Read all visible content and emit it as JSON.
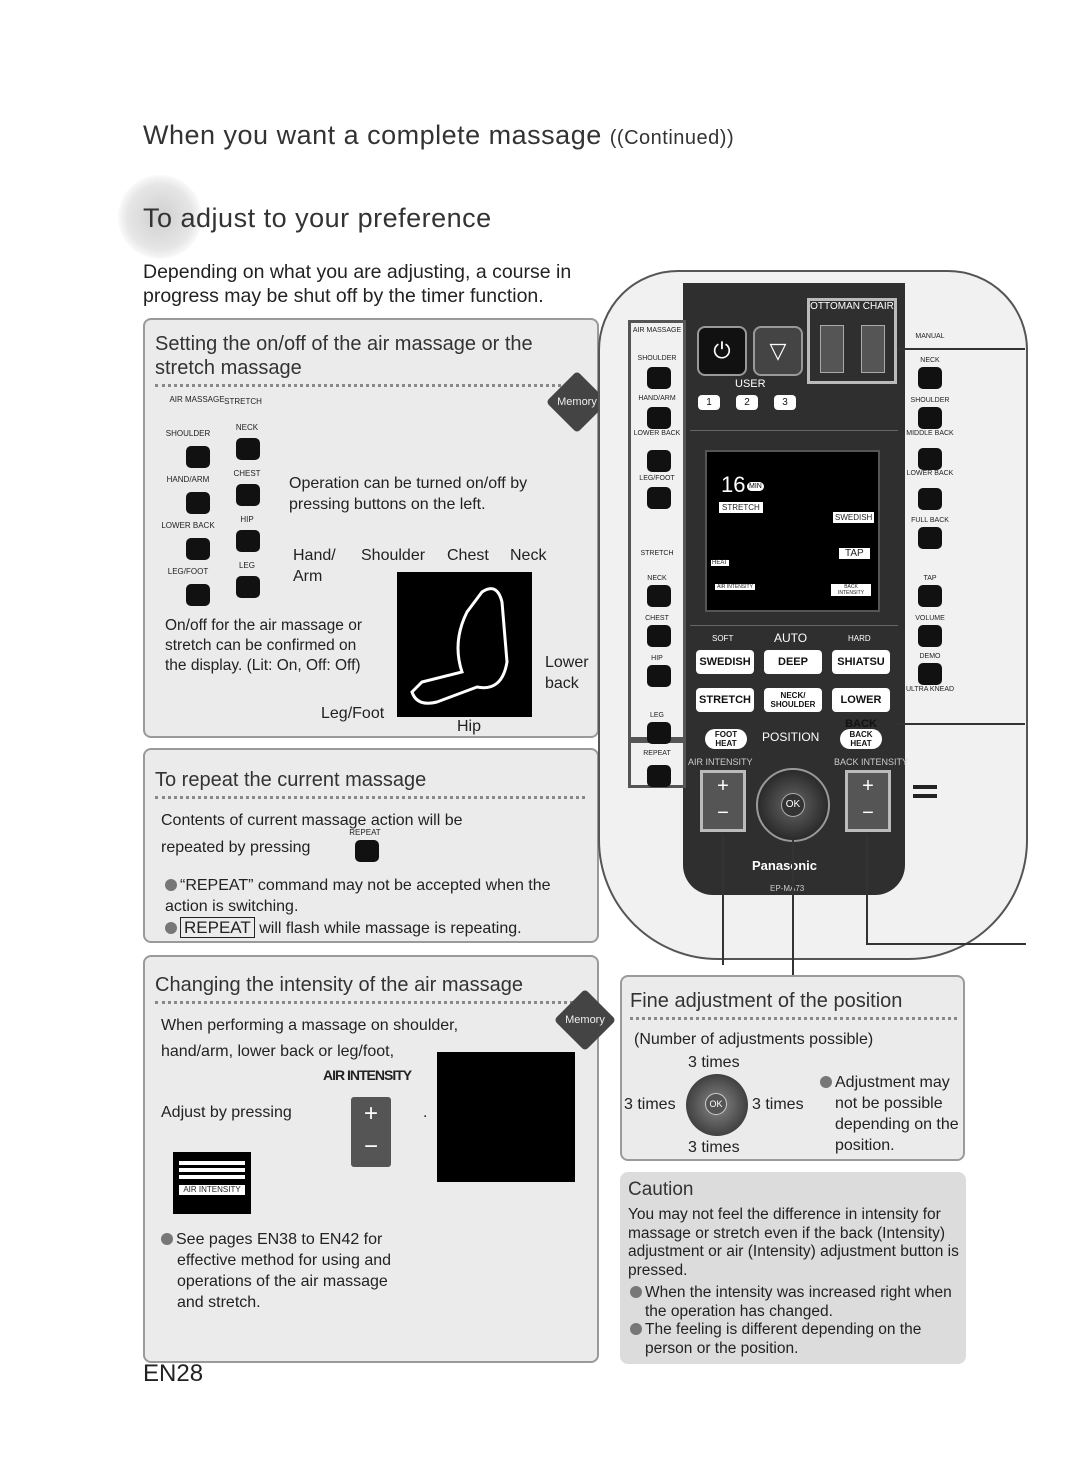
{
  "header": {
    "title": "When you want a complete massage",
    "title_suffix": "(Continued)",
    "subtitle": "To adjust to your preference",
    "intro": "Depending on what you are adjusting, a course in progress may be shut off by the timer function."
  },
  "section_onoff": {
    "title": "Setting the on/off of the air massage or the stretch massage",
    "memory": "Memory",
    "col_air": "AIR MASSAGE",
    "col_stretch": "STRETCH",
    "air_buttons": [
      "SHOULDER",
      "HAND/ARM",
      "LOWER BACK",
      "LEG/FOOT"
    ],
    "stretch_buttons": [
      "NECK",
      "CHEST",
      "HIP",
      "LEG"
    ],
    "note": "Operation can be turned on/off by pressing buttons on the left.",
    "labels": {
      "hand_arm": "Hand/ Arm",
      "shoulder": "Shoulder",
      "chest": "Chest",
      "neck": "Neck",
      "lower_back": "Lower back",
      "leg_foot": "Leg/Foot",
      "hip": "Hip"
    },
    "display_note": "On/off for the air massage or stretch can be confirmed on the display. (Lit: On, Off: Off)"
  },
  "section_repeat": {
    "title": "To repeat the current massage",
    "line1": "Contents of current massage action will be",
    "line2": "repeated by pressing",
    "button_label": "REPEAT",
    "bullet1": "“REPEAT” command may not be accepted when the action is switching.",
    "repeat_badge": "REPEAT",
    "bullet2": "will flash while massage is repeating."
  },
  "section_air": {
    "title": "Changing the intensity of the air massage",
    "memory": "Memory",
    "line1": "When performing a massage on shoulder,",
    "line2": "hand/arm, lower back or leg/foot,",
    "air_intensity": "AIR INTENSITY",
    "adjust": "Adjust by pressing",
    "period": ".",
    "indicator": "AIR INTENSITY",
    "note": "See pages EN38 to EN42 for effective method for using and operations of the air massage and stretch."
  },
  "section_position": {
    "title": "Fine adjustment of the position",
    "subtitle": "(Number of adjustments possible)",
    "up": "3 times",
    "left": "3 times",
    "right": "3 times",
    "down": "3 times",
    "ok": "OK",
    "note": "Adjustment may not be possible depending on the position."
  },
  "caution": {
    "title": "Caution",
    "text": "You may not feel the difference in intensity for massage or stretch even if the back (Intensity) adjustment or air (Intensity) adjustment button is pressed.",
    "bullet1": "When the intensity was increased right when the operation has changed.",
    "bullet2": "The feeling is different depending on the person or the position."
  },
  "remote": {
    "left_title": "AIR MASSAGE",
    "left_air": [
      "SHOULDER",
      "HAND/ARM",
      "LOWER BACK",
      "LEG/FOOT"
    ],
    "stretch_label": "STRETCH",
    "left_stretch": [
      "NECK",
      "CHEST",
      "HIP",
      "LEG"
    ],
    "repeat": "REPEAT",
    "ottoman_chair": "OTTOMAN CHAIR",
    "user": "USER",
    "user_buttons": [
      "1",
      "2",
      "3"
    ],
    "right_title": "MANUAL",
    "right_buttons": [
      "NECK",
      "SHOULDER",
      "MIDDLE BACK",
      "LOWER BACK",
      "FULL BACK",
      "TAP",
      "VOLUME",
      "DEMO"
    ],
    "ultra_knead": "ULTRA KNEAD",
    "lcd": {
      "minutes": "16",
      "min": "MIN",
      "stretch": "STRETCH",
      "swedish": "SWEDISH",
      "tap": "TAP",
      "heat": "HEAT",
      "air_intensity": "AIR INTENSITY",
      "back_intensity": "BACK INTENSITY"
    },
    "soft": "SOFT",
    "auto": "AUTO",
    "hard": "HARD",
    "courses": [
      "SWEDISH",
      "DEEP",
      "SHIATSU",
      "STRETCH",
      "NECK/ SHOULDER",
      "LOWER BACK"
    ],
    "foot_heat": "FOOT HEAT",
    "position": "POSITION",
    "back_heat": "BACK HEAT",
    "air_intensity": "AIR INTENSITY",
    "back_intensity": "BACK INTENSITY",
    "ok": "OK",
    "brand": "Panasonic",
    "model": "EP-MA73"
  },
  "page_number": "EN28"
}
